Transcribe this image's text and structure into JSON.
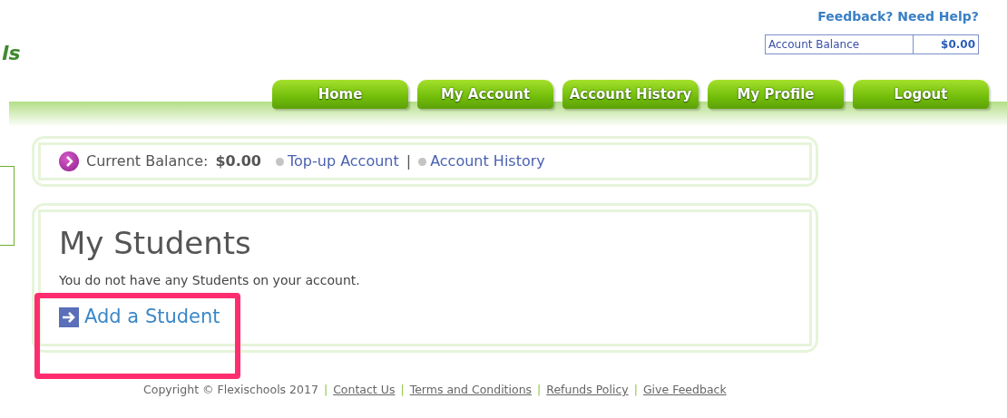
{
  "logo": {
    "text": "ls"
  },
  "help_link": "Feedback? Need Help?",
  "account_balance": {
    "label": "Account Balance",
    "value": "$0.00"
  },
  "nav_tabs": [
    {
      "label": "Home"
    },
    {
      "label": "My Account"
    },
    {
      "label": "Account History"
    },
    {
      "label": "My Profile"
    },
    {
      "label": "Logout"
    }
  ],
  "balance_bar": {
    "label": "Current Balance:",
    "amount": "$0.00",
    "links": [
      "Top-up Account",
      "Account History"
    ],
    "separator": "|"
  },
  "students": {
    "title": "My Students",
    "message": "You do not have any Students on your account.",
    "add_link": "Add a Student"
  },
  "annotation": {
    "kind": "highlight"
  },
  "footer": {
    "copyright": "Copyright © Flexischools 2017",
    "separator": "|",
    "links": [
      "Contact Us",
      "Terms and Conditions",
      "Refunds Policy",
      "Give Feedback"
    ]
  }
}
